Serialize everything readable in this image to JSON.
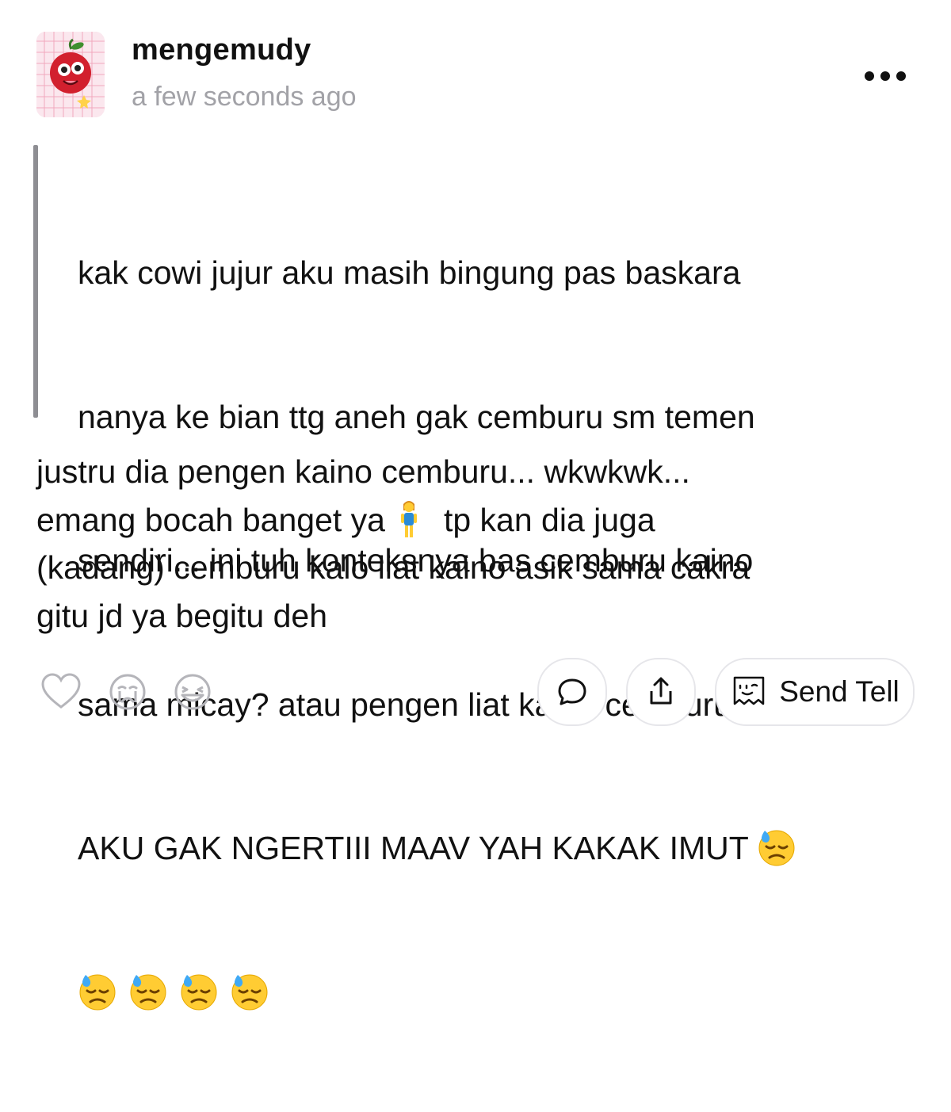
{
  "post": {
    "username": "mengemudy",
    "timestamp": "a few seconds ago"
  },
  "question": {
    "lines": [
      "kak cowi jujur aku masih bingung pas baskara",
      "nanya ke bian ttg aneh gak cemburu sm temen",
      "sendiri... ini tuh konteksnya bas cemburu kaino",
      "sama micay? atau pengen liat kaino cemburu?",
      "AKU GAK NGERTIII MAAV YAH KAKAK IMUT"
    ],
    "emoji": "downcast-face-with-sweat"
  },
  "answer": {
    "line1": "justru dia pengen kaino cemburu... wkwkwk...",
    "line2_before": "emang bocah banget ya",
    "line2_after": "tp kan dia juga",
    "line3": "(kadang) cemburu kalo liat kaino asik sama cakra",
    "line4": "gitu jd ya begitu deh",
    "emoji": "standing-woman"
  },
  "actions": {
    "send_tell_label": "Send Tell"
  },
  "colors": {
    "quote_bar": "#8e8e93",
    "timestamp": "#a2a2a7",
    "icon_gray": "#b5b5ba"
  }
}
